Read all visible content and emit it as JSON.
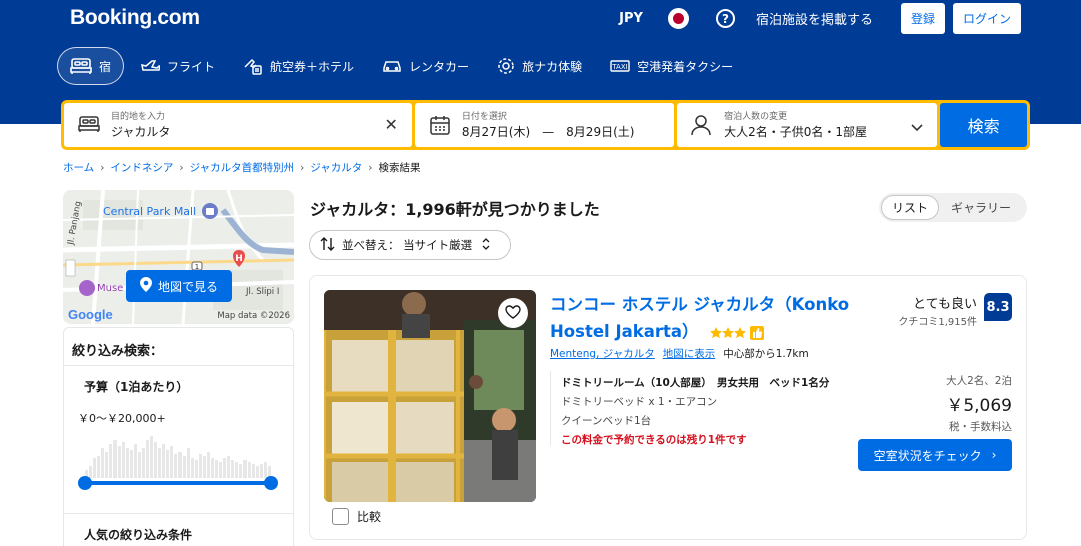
{
  "header": {
    "logo": "Booking.com",
    "currency": "JPY",
    "list_property": "宿泊施設を掲載する",
    "register": "登録",
    "login": "ログイン"
  },
  "nav": [
    {
      "label": "宿",
      "icon": "bed-icon"
    },
    {
      "label": "フライト",
      "icon": "plane-icon"
    },
    {
      "label": "航空券＋ホテル",
      "icon": "plane-hotel-icon"
    },
    {
      "label": "レンタカー",
      "icon": "car-icon"
    },
    {
      "label": "旅ナカ体験",
      "icon": "attraction-icon"
    },
    {
      "label": "空港発着タクシー",
      "icon": "taxi-icon"
    }
  ],
  "search": {
    "dest_label": "目的地を入力",
    "dest_value": "ジャカルタ",
    "date_label": "日付を選択",
    "date_value": "8月27日(木)　—　8月29日(土)",
    "guest_label": "宿泊人数の変更",
    "guest_value": "大人2名・子供0名・1部屋",
    "button": "検索"
  },
  "breadcrumb": [
    "ホーム",
    "インドネシア",
    "ジャカルタ首都特別州",
    "ジャカルタ",
    "検索結果"
  ],
  "map": {
    "button": "地図で見る",
    "labels": {
      "mall": "Central Park Mall",
      "road1": "Jl. Panjang",
      "road2": "Jl. Slipi I",
      "museum": "Muse",
      "data": "Map data ©2026",
      "google": "Google"
    }
  },
  "filters": {
    "title": "絞り込み検索：",
    "budget_title": "予算（1泊あたり）",
    "budget_range": "￥0〜￥20,000+",
    "popular_title": "人気の絞り込み条件"
  },
  "results": {
    "title": "ジャカルタ：1,996軒が見つかりました",
    "view_list": "リスト",
    "view_gallery": "ギャラリー",
    "sort_label": "並べ替え：  当サイト厳選"
  },
  "hotel": {
    "name": "コンコー ホステル ジャカルタ（Konko Hostel Jakarta）",
    "stars": 3,
    "area": "Menteng, ジャカルタ",
    "map_link": "地図に表示",
    "distance": "中心部から1.7km",
    "rating_word": "とても良い",
    "review_count": "クチコミ1,915件",
    "score": "8.3",
    "room_name": "ドミトリールーム（10人部屋）　男女共用　ベッド1名分",
    "room_detail1": "ドミトリーベッド x 1・エアコン",
    "room_detail2": "クイーンベッド1台",
    "room_warning": "この料金で予約できるのは残り1件です",
    "stay": "大人2名、2泊",
    "price": "￥5,069",
    "tax": "税・手数料込",
    "availability_button": "空室状況をチェック",
    "compare": "比較"
  },
  "colors": {
    "brand": "#003b95",
    "accent": "#006ce4",
    "search_border": "#febb02",
    "warning": "#d4111e"
  }
}
